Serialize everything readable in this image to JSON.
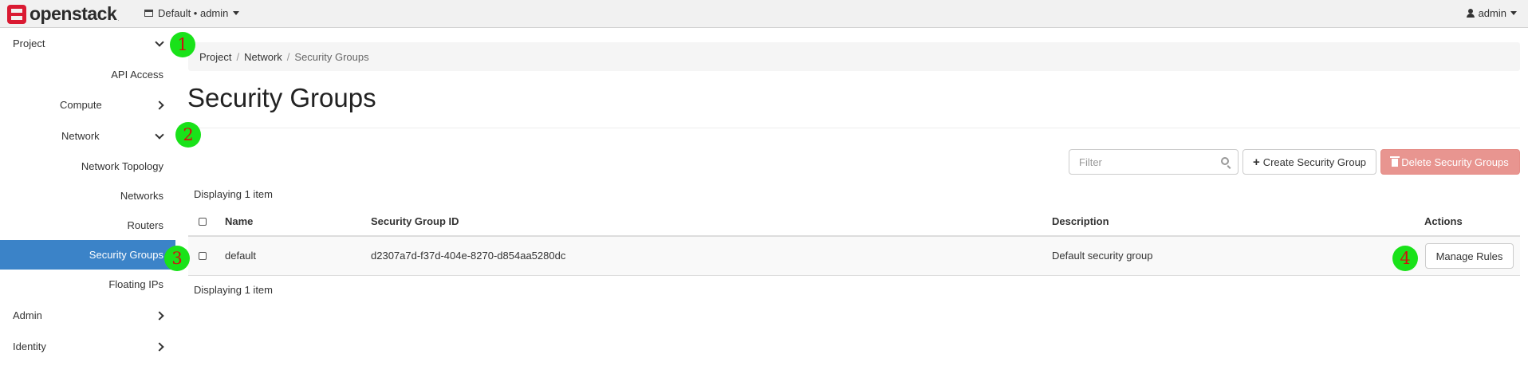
{
  "topbar": {
    "logo_text": "openstack",
    "logo_dot": ".",
    "project_selector": "Default • admin",
    "user_menu": "admin"
  },
  "sidebar": {
    "items": [
      {
        "label": "Project",
        "chevron": "down"
      },
      {
        "label": "API Access"
      },
      {
        "label": "Compute",
        "chevron": "right"
      },
      {
        "label": "Network",
        "chevron": "down"
      },
      {
        "label": "Network Topology"
      },
      {
        "label": "Networks"
      },
      {
        "label": "Routers"
      },
      {
        "label": "Security Groups",
        "active": true
      },
      {
        "label": "Floating IPs"
      },
      {
        "label": "Admin",
        "chevron": "right"
      },
      {
        "label": "Identity",
        "chevron": "right"
      }
    ]
  },
  "markers": [
    "1",
    "2",
    "3",
    "4"
  ],
  "breadcrumb": {
    "items": [
      "Project",
      "Network"
    ],
    "current": "Security Groups",
    "separator": "/"
  },
  "page_title": "Security Groups",
  "toolbar": {
    "filter_placeholder": "Filter",
    "create_label": "Create Security Group",
    "delete_label": "Delete Security Groups"
  },
  "table": {
    "count_top": "Displaying 1 item",
    "count_bottom": "Displaying 1 item",
    "columns": [
      "Name",
      "Security Group ID",
      "Description",
      "Actions"
    ],
    "rows": [
      {
        "name": "default",
        "id": "d2307a7d-f37d-404e-8270-d854aa5280dc",
        "description": "Default security group",
        "action": "Manage Rules"
      }
    ]
  },
  "colors": {
    "active_nav": "#3b83c8",
    "delete_button": "#e89590",
    "marker": "#19e219",
    "marker_text": "#d01010",
    "logo_red": "#da1a32"
  }
}
